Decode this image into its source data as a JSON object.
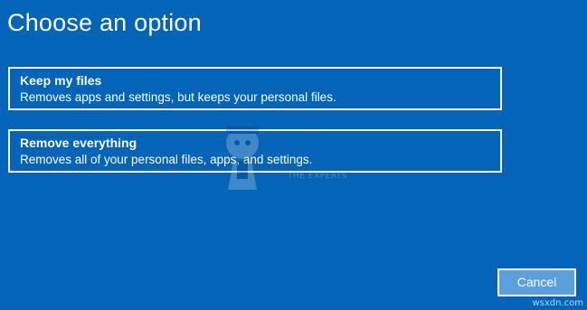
{
  "page": {
    "title": "Choose an option"
  },
  "options": [
    {
      "title": "Keep my files",
      "description": "Removes apps and settings, but keeps your personal files."
    },
    {
      "title": "Remove everything",
      "description": "Removes all of your personal files, apps, and settings."
    }
  ],
  "watermark": {
    "text": "THE EXPERTS"
  },
  "buttons": {
    "cancel_label": "Cancel"
  },
  "footer": {
    "site": "wsxdn.com"
  },
  "colors": {
    "background": "#0364b8",
    "border": "#ffffff",
    "cancel_fill": "#5aa0de"
  }
}
